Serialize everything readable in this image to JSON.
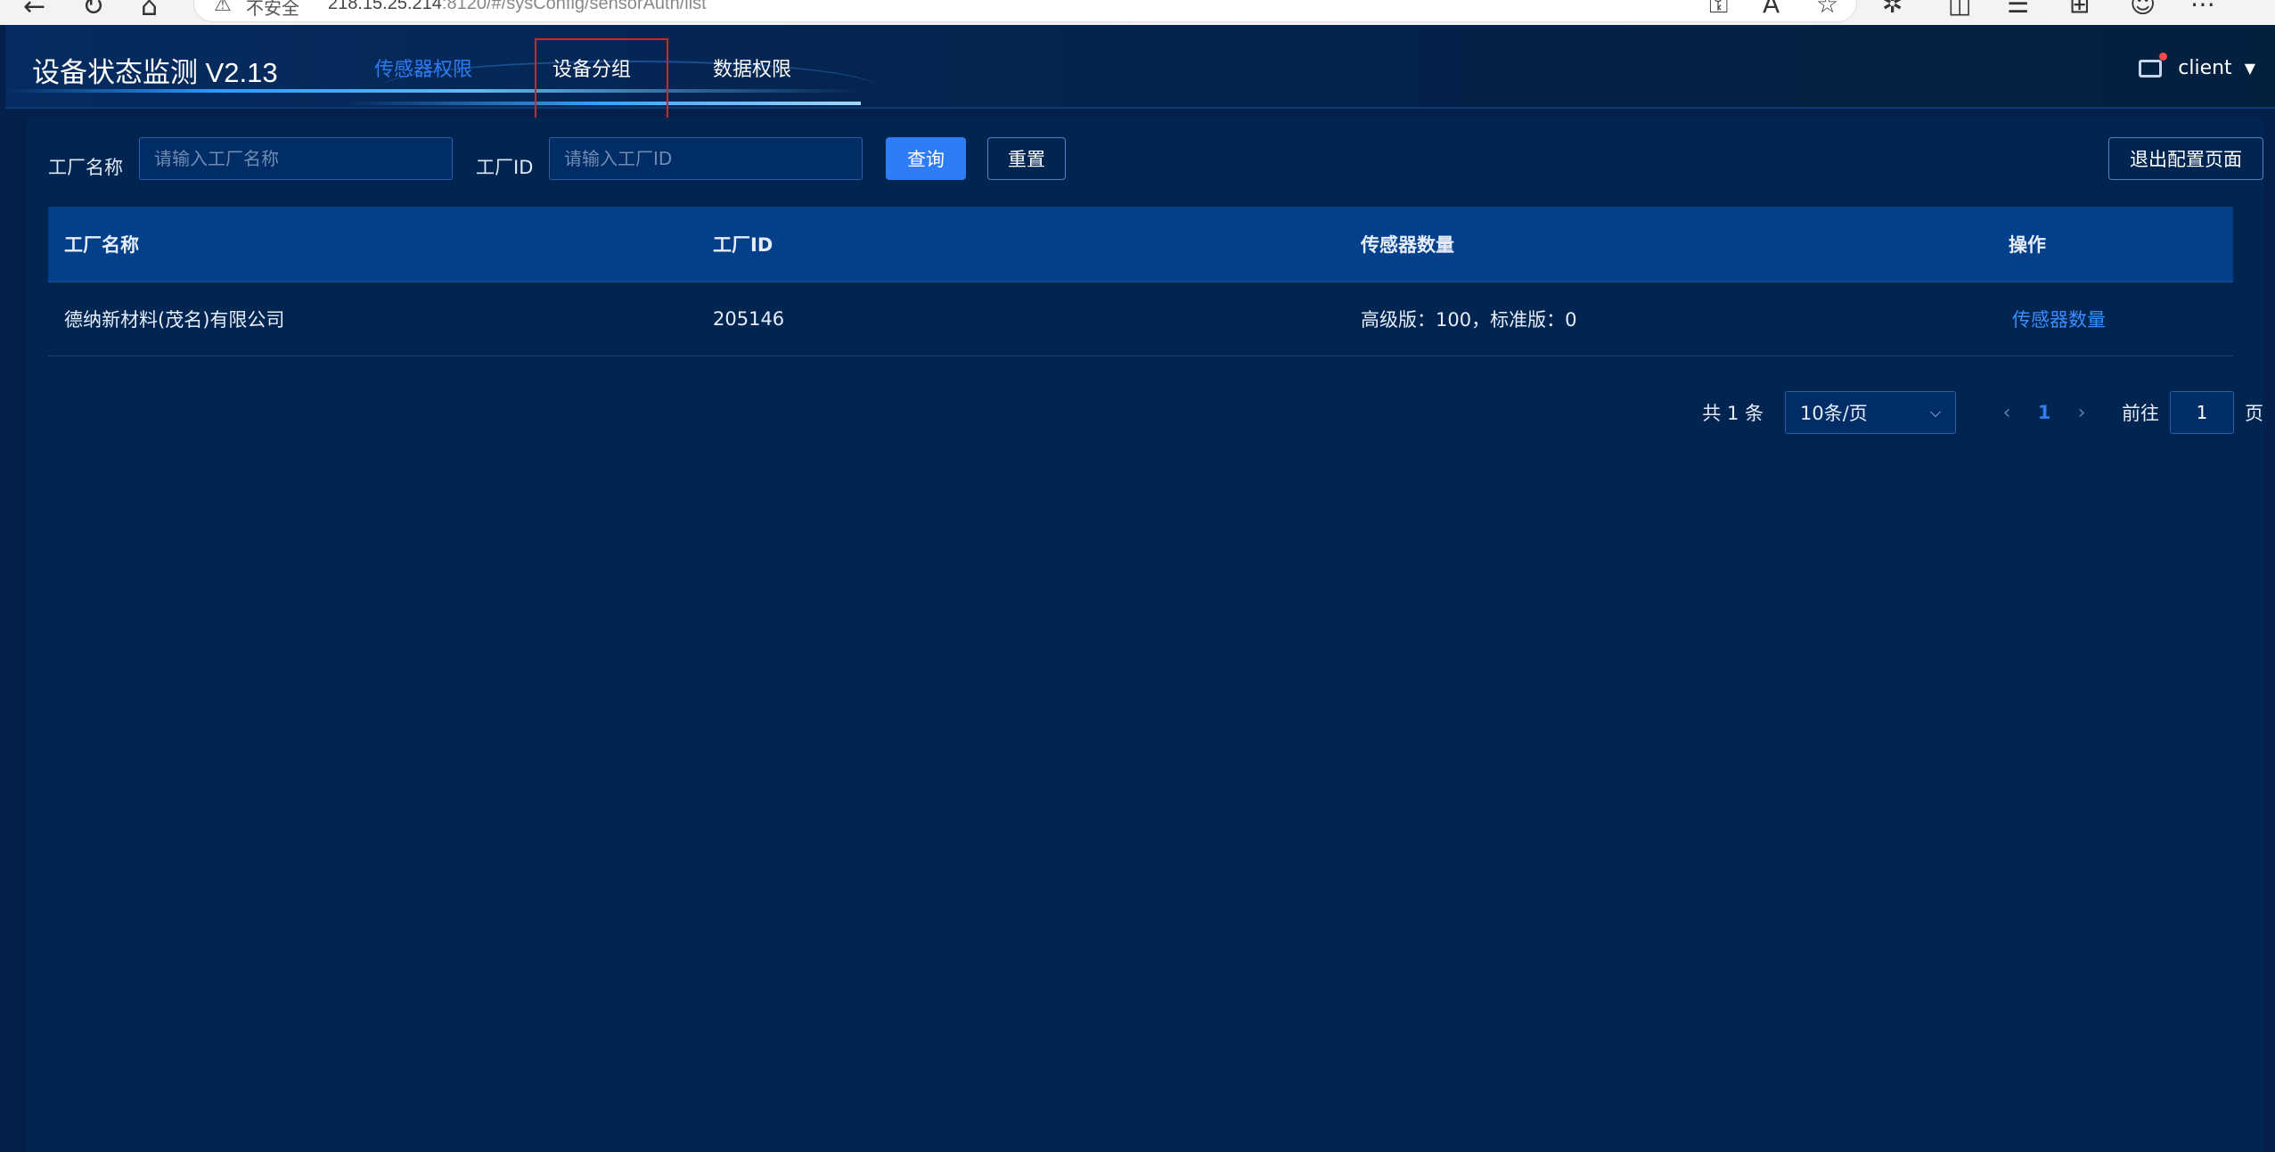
{
  "browser": {
    "security_label": "不安全",
    "url_host": "218.15.25.214",
    "url_rest": ":8120/#/sysConfig/sensorAuth/list"
  },
  "header": {
    "app_title": "设备状态监测 V2.13",
    "nav": [
      {
        "label": "传感器权限",
        "active": true
      },
      {
        "label": "设备分组",
        "active": false
      },
      {
        "label": "数据权限",
        "active": false
      }
    ],
    "user": "client"
  },
  "filters": {
    "factory_name_label": "工厂名称",
    "factory_name_placeholder": "请输入工厂名称",
    "factory_id_label": "工厂ID",
    "factory_id_placeholder": "请输入工厂ID",
    "query_label": "查询",
    "reset_label": "重置",
    "exit_label": "退出配置页面"
  },
  "table": {
    "headers": [
      "工厂名称",
      "工厂ID",
      "传感器数量",
      "操作"
    ],
    "rows": [
      {
        "name": "德纳新材料(茂名)有限公司",
        "id": "205146",
        "sensors": "高级版：100，标准版：0",
        "action": "传感器数量"
      }
    ]
  },
  "pagination": {
    "total": "共 1 条",
    "page_size": "10条/页",
    "current_page": "1",
    "goto_label": "前往",
    "goto_value": "1",
    "page_unit": "页"
  },
  "colors": {
    "background": "#02204a",
    "header_row": "#04408a",
    "accent": "#2e7cf6",
    "highlight_box": "#e0201d"
  }
}
